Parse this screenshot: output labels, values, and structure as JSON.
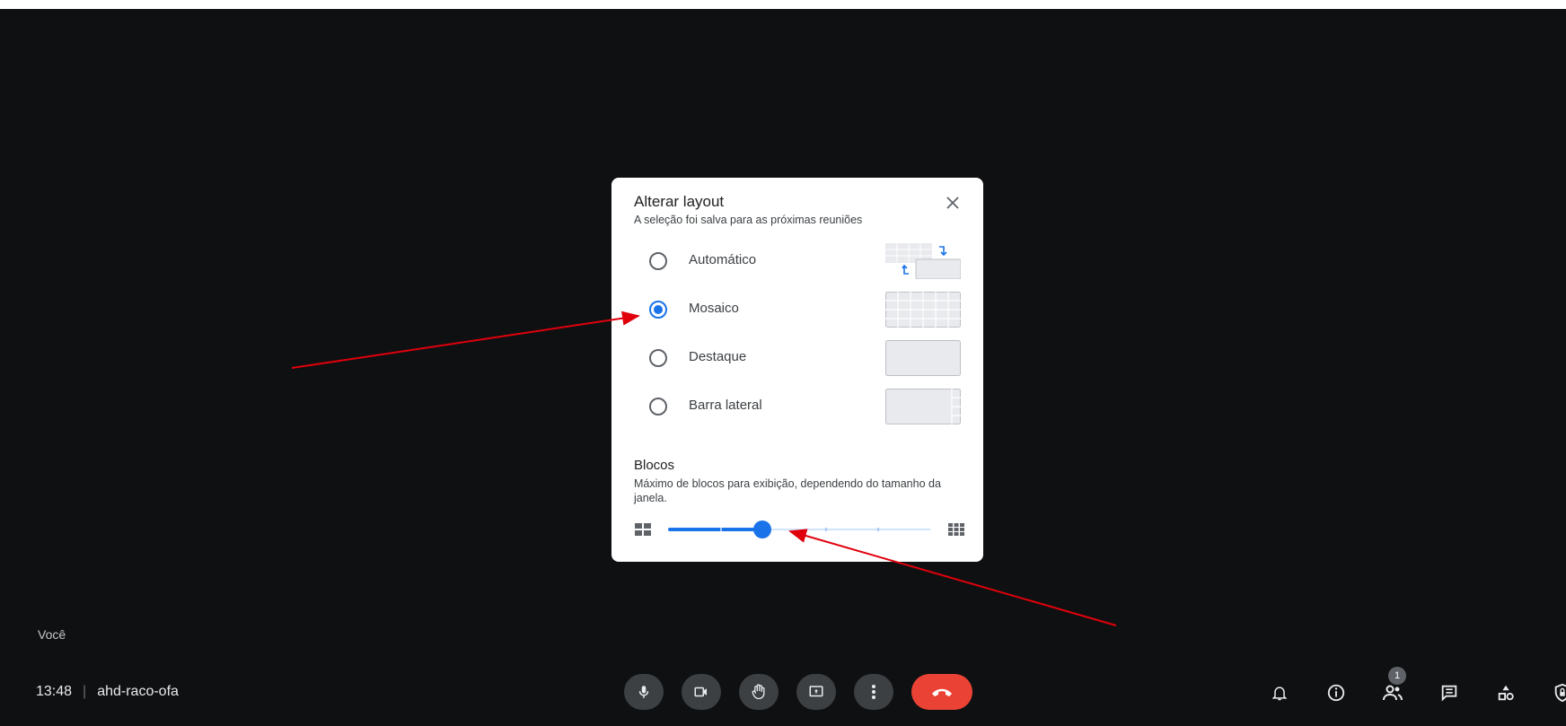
{
  "stage": {
    "self_label": "Você"
  },
  "meeting": {
    "time": "13:48",
    "separator": "|",
    "code": "ahd-raco-ofa"
  },
  "controls": [
    {
      "name": "microphone-button",
      "icon": "mic-icon"
    },
    {
      "name": "camera-button",
      "icon": "camera-icon"
    },
    {
      "name": "raise-hand-button",
      "icon": "hand-icon"
    },
    {
      "name": "present-button",
      "icon": "present-icon"
    },
    {
      "name": "more-options-button",
      "icon": "more-vert-icon"
    },
    {
      "name": "leave-call-button",
      "icon": "call-end-icon"
    }
  ],
  "right_icons": {
    "participants_badge": "1"
  },
  "dialog": {
    "title": "Alterar layout",
    "subtitle": "A seleção foi salva para as próximas reuniões",
    "options": [
      {
        "label": "Automático",
        "selected": false
      },
      {
        "label": "Mosaico",
        "selected": true
      },
      {
        "label": "Destaque",
        "selected": false
      },
      {
        "label": "Barra lateral",
        "selected": false
      }
    ],
    "tiles": {
      "title": "Blocos",
      "description": "Máximo de blocos para exibição, dependendo do tamanho da janela.",
      "slider_value_fraction": 0.36
    }
  },
  "colors": {
    "accent": "#1a73e8",
    "end_call": "#ea4335",
    "annotation_arrow": "#e0000c",
    "background": "#0f1012"
  }
}
